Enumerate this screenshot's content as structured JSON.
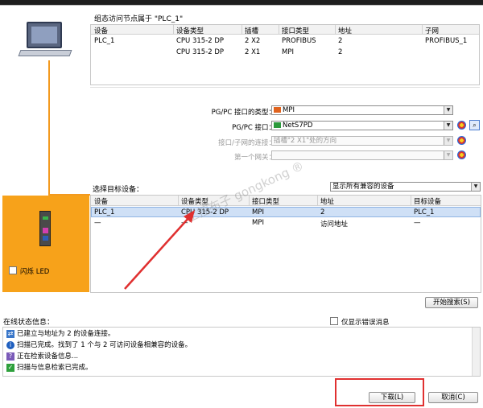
{
  "window": {
    "title_fragment": ""
  },
  "node_section": {
    "title": "组态访问节点属于 \"PLC_1\"",
    "headers": [
      "设备",
      "设备类型",
      "插槽",
      "接口类型",
      "地址",
      "子网"
    ],
    "rows": [
      [
        "PLC_1",
        "CPU 315-2 DP",
        "2 X2",
        "PROFIBUS",
        "2",
        "PROFIBUS_1"
      ],
      [
        "",
        "CPU 315-2 DP",
        "2 X1",
        "MPI",
        "2",
        ""
      ]
    ]
  },
  "form": {
    "pgpc_type_label": "PG/PC 接口的类型：",
    "pgpc_type_value": "MPI",
    "pgpc_if_label": "PG/PC 接口：",
    "pgpc_if_value": "NetS7PD",
    "subnet_conn_label": "接口/子网的连接：",
    "subnet_conn_value": "插槽\"2 X1\"处的方向",
    "gateway_label": "第一个网关：",
    "gateway_value": ""
  },
  "target": {
    "label": "选择目标设备：",
    "filter_value": "显示所有兼容的设备",
    "headers": [
      "设备",
      "设备类型",
      "接口类型",
      "地址",
      "目标设备"
    ],
    "rows": [
      [
        "PLC_1",
        "CPU 315-2 DP",
        "MPI",
        "2",
        "PLC_1"
      ],
      [
        "—",
        "—",
        "MPI",
        "访问地址",
        "—"
      ]
    ]
  },
  "flash_led_label": "闪烁 LED",
  "start_search_button": "开始搜索(S)",
  "online_status_label": "在线状态信息：",
  "only_errors_label": "仅显示错误消息",
  "status_messages": [
    {
      "icon": "connected-icon",
      "text": "已建立与地址为 2 的设备连接。"
    },
    {
      "icon": "info-icon",
      "text": "扫描已完成。找到了 1 个与 2 可访问设备相兼容的设备。"
    },
    {
      "icon": "search-icon",
      "text": "正在检索设备信息..."
    },
    {
      "icon": "check-icon",
      "text": "扫描与信息检索已完成。"
    }
  ],
  "download_button": "下载(L)",
  "cancel_button": "取消(C)",
  "watermark": "工控布子 gongkong ®"
}
